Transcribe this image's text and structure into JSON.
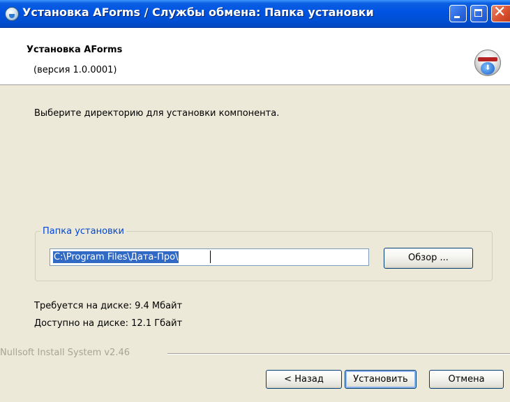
{
  "window": {
    "title": "Установка AForms / Службы обмена: Папка установки",
    "controls": {
      "minimize_icon": "minimize-icon",
      "maximize_icon": "maximize-icon",
      "close_icon": "close-icon"
    }
  },
  "header": {
    "title": "Установка AForms",
    "version": "(версия 1.0.0001)",
    "logo_icon": "nsis-installer-icon"
  },
  "body": {
    "instruction": "Выберите директорию для установки компонента.",
    "install_group": {
      "label": "Папка установки",
      "path_value": "C:\\Program Files\\Дата-Про\\",
      "browse_label": "Обзор ..."
    },
    "space_required": "Требуется на диске: 9.4 Мбайт",
    "space_available": "Доступно на диске: 12.1 Гбайт"
  },
  "footer": {
    "branding": "Nullsoft Install System v2.46",
    "back_label": "< Назад",
    "install_label": "Установить",
    "cancel_label": "Отмена"
  },
  "colors": {
    "titlebar": "#0054e3",
    "dialog_bg": "#ece9d8",
    "group_label": "#0046d5",
    "selection": "#316ac5"
  }
}
